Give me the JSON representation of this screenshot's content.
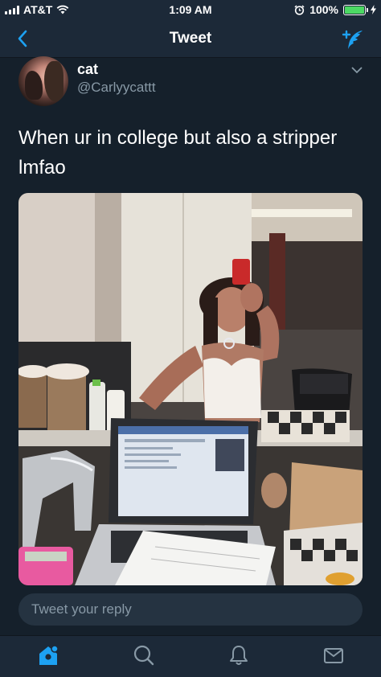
{
  "status_bar": {
    "carrier": "AT&T",
    "time": "1:09 AM",
    "battery": "100%",
    "battery_level": 1.0
  },
  "nav": {
    "title": "Tweet",
    "back_icon": "chevron-left-icon",
    "compose_icon": "compose-tweet-icon"
  },
  "tweet": {
    "name": "cat",
    "handle": "@Carlyycattt",
    "text": "When ur in college but also a stripper lmfao"
  },
  "reply": {
    "placeholder": "Tweet your reply"
  },
  "tabs": [
    {
      "name": "home",
      "icon": "home-icon",
      "active": true
    },
    {
      "name": "search",
      "icon": "search-icon",
      "active": false
    },
    {
      "name": "notifications",
      "icon": "bell-icon",
      "active": false
    },
    {
      "name": "messages",
      "icon": "mail-icon",
      "active": false
    }
  ],
  "colors": {
    "background": "#15202b",
    "accent": "#1da1f2",
    "secondary_text": "#8899a6",
    "battery": "#4cd964"
  }
}
